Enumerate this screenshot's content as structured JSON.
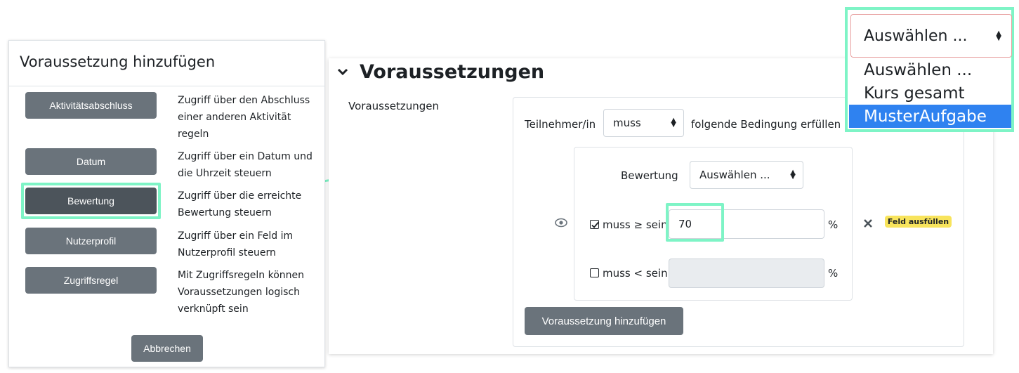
{
  "modal": {
    "title": "Voraussetzung hinzufügen",
    "items": [
      {
        "label": "Aktivitätsabschluss",
        "desc": "Zugriff über den Abschluss einer anderen Aktivität regeln"
      },
      {
        "label": "Datum",
        "desc": "Zugriff über ein Datum und die Uhrzeit steuern"
      },
      {
        "label": "Bewertung",
        "desc": "Zugriff über die erreichte Bewertung steuern"
      },
      {
        "label": "Nutzerprofil",
        "desc": "Zugriff über ein Feld im Nutzerprofil steuern"
      },
      {
        "label": "Zugriffsregel",
        "desc": "Mit Zugriffsregeln können Voraussetzungen logisch verknüpft sein"
      }
    ],
    "cancel_label": "Abbrechen"
  },
  "panel": {
    "section_title": "Voraussetzungen",
    "field_label": "Voraussetzungen",
    "participant_label": "Teilnehmer/in",
    "must_select": "muss",
    "condition_text": "folgende Bedingung erfüllen",
    "grade_label": "Bewertung",
    "grade_select": "Auswählen ...",
    "min_label": "muss ≥ sein",
    "min_value": "70",
    "max_label": "muss < sein",
    "max_value": "",
    "percent": "%",
    "required_badge": "Feld ausfüllen",
    "add_button": "Voraussetzung hinzufügen"
  },
  "dropdown": {
    "selected": "Auswählen ...",
    "options": [
      "Auswählen ...",
      "Kurs gesamt",
      "MusterAufgabe"
    ],
    "highlighted": "MusterAufgabe"
  },
  "colors": {
    "highlight": "#7ef4c6",
    "button_gray": "#6a737b",
    "option_selected": "#2f82f0",
    "badge": "#f8e45c"
  }
}
